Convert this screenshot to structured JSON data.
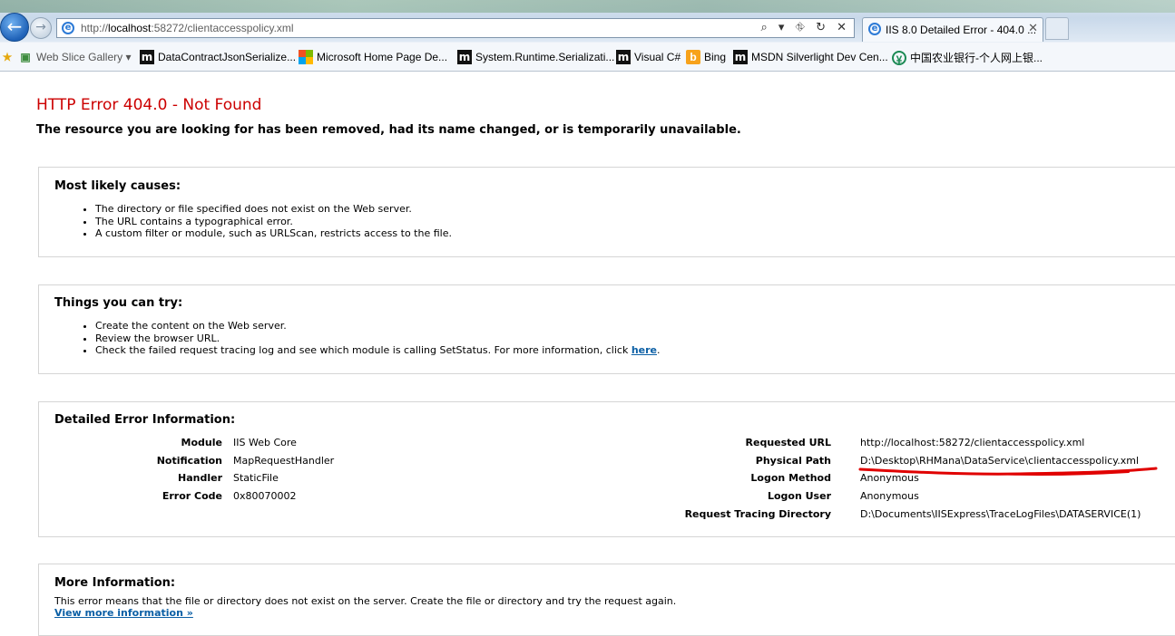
{
  "browser": {
    "address_url_prefix": "http://",
    "address_url_host": "localhost",
    "address_url_rest": ":58272/clientaccesspolicy.xml",
    "address_tools": "⌕ ▾ ⛗ ↻ ✕",
    "tab_title": "IIS 8.0 Detailed Error - 404.0 ...",
    "tab_close": "✕"
  },
  "favorites": [
    {
      "label": "Web Slice Gallery ▾",
      "icon": "web-slice-icon"
    },
    {
      "label": "DataContractJsonSerialize...",
      "icon": "msdn-m-icon"
    },
    {
      "label": "Microsoft Home Page  De...",
      "icon": "microsoft-logo-icon"
    },
    {
      "label": "System.Runtime.Serializati...",
      "icon": "msdn-m-icon"
    },
    {
      "label": "Visual C#",
      "icon": "msdn-m-icon"
    },
    {
      "label": "Bing",
      "icon": "bing-icon"
    },
    {
      "label": "MSDN Silverlight Dev Cen...",
      "icon": "msdn-m-icon"
    },
    {
      "label": "中国农业银行-个人网上银...",
      "icon": "abc-bank-icon"
    }
  ],
  "error": {
    "title": "HTTP Error 404.0 - Not Found",
    "subtitle": "The resource you are looking for has been removed, had its name changed, or is temporarily unavailable."
  },
  "causes": {
    "heading": "Most likely causes:",
    "items": [
      "The directory or file specified does not exist on the Web server.",
      "The URL contains a typographical error.",
      "A custom filter or module, such as URLScan, restricts access to the file."
    ]
  },
  "try": {
    "heading": "Things you can try:",
    "items": [
      "Create the content on the Web server.",
      "Review the browser URL.",
      "Check the failed request tracing log and see which module is calling SetStatus. For more information, click "
    ],
    "link_label": "here",
    "link_suffix": "."
  },
  "details": {
    "heading": "Detailed Error Information:",
    "left": [
      {
        "label": "Module",
        "value": "IIS Web Core"
      },
      {
        "label": "Notification",
        "value": "MapRequestHandler"
      },
      {
        "label": "Handler",
        "value": "StaticFile"
      },
      {
        "label": "Error Code",
        "value": "0x80070002"
      }
    ],
    "right": [
      {
        "label": "Requested URL",
        "value": "http://localhost:58272/clientaccesspolicy.xml"
      },
      {
        "label": "Physical Path",
        "value": "D:\\Desktop\\RHMana\\DataService\\clientaccesspolicy.xml"
      },
      {
        "label": "Logon Method",
        "value": "Anonymous"
      },
      {
        "label": "Logon User",
        "value": "Anonymous"
      },
      {
        "label": "Request Tracing Directory",
        "value": "D:\\Documents\\IISExpress\\TraceLogFiles\\DATASERVICE(1)"
      }
    ]
  },
  "more": {
    "heading": "More Information:",
    "text": "This error means that the file or directory does not exist on the server. Create the file or directory and try the request again.",
    "link_label": "View more information »"
  },
  "colors": {
    "error_title": "#cc0000",
    "link": "#0b5fa5",
    "annotation": "#e00000"
  }
}
